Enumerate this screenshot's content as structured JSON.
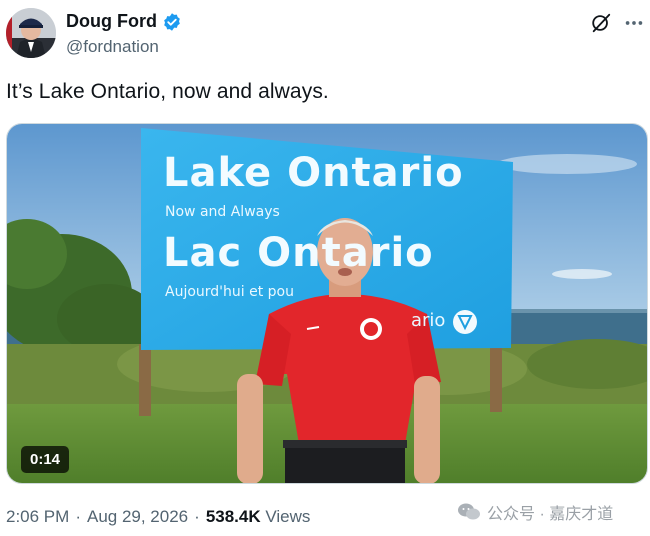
{
  "author": {
    "name": "Doug Ford",
    "handle": "@fordnation",
    "verified_color": "#1d9bf0"
  },
  "tweet": {
    "text": "It’s Lake Ontario, now and always."
  },
  "media": {
    "sign_line1": "Lake Ontario",
    "sign_line2": "Now and Always",
    "sign_line3": "Lac Ontario",
    "sign_line4": "Aujourd'hui et pou",
    "sign_line5": "ario",
    "duration": "0:14"
  },
  "meta": {
    "time": "2:06 PM",
    "separator": "·",
    "date": "Aug 29, 2026",
    "views_count": "538.4K",
    "views_label": "Views"
  },
  "watermark": {
    "text": "公众号 · 嘉庆才道"
  },
  "icons": {
    "verified": "verified-badge-icon",
    "grok": "grok-icon",
    "more": "more-options-icon",
    "watermark": "wechat-icon"
  }
}
